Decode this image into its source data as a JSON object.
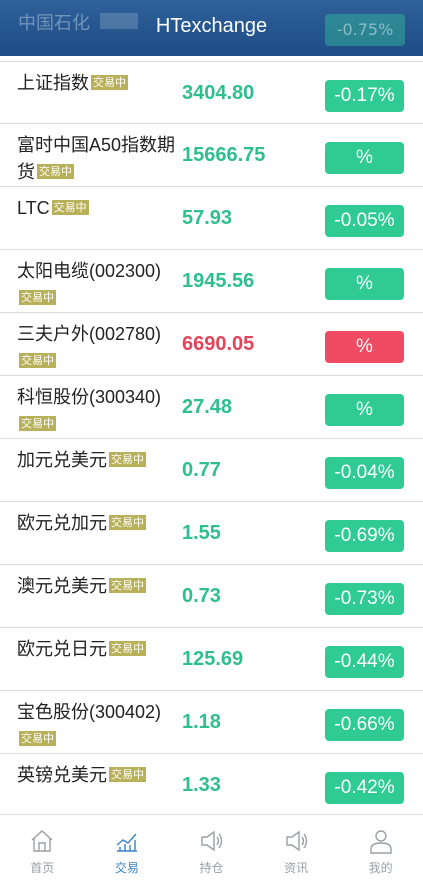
{
  "header": {
    "title": "HTexchange",
    "ghost_name": "中国石化",
    "ghost_change": "-0.75%"
  },
  "badge_text": "交易中",
  "rows": [
    {
      "name": "上证指数",
      "price": "3404.80",
      "change": "-0.17%",
      "direction": "up"
    },
    {
      "name": "富时中国A50指数期货",
      "price": "15666.75",
      "change": "%",
      "direction": "up"
    },
    {
      "name": "LTC",
      "price": "57.93",
      "change": "-0.05%",
      "direction": "up"
    },
    {
      "name": "太阳电缆(002300)",
      "price": "1945.56",
      "change": "%",
      "direction": "up"
    },
    {
      "name": "三夫户外(002780)",
      "price": "6690.05",
      "change": "%",
      "direction": "down"
    },
    {
      "name": "科恒股份(300340)",
      "price": "27.48",
      "change": "%",
      "direction": "up"
    },
    {
      "name": "加元兑美元",
      "price": "0.77",
      "change": "-0.04%",
      "direction": "up"
    },
    {
      "name": "欧元兑加元",
      "price": "1.55",
      "change": "-0.69%",
      "direction": "up"
    },
    {
      "name": "澳元兑美元",
      "price": "0.73",
      "change": "-0.73%",
      "direction": "up"
    },
    {
      "name": "欧元兑日元",
      "price": "125.69",
      "change": "-0.44%",
      "direction": "up"
    },
    {
      "name": "宝色股份(300402)",
      "price": "1.18",
      "change": "-0.66%",
      "direction": "up"
    },
    {
      "name": "英镑兑美元",
      "price": "1.33",
      "change": "-0.42%",
      "direction": "up"
    }
  ],
  "tabs": [
    {
      "label": "首页",
      "icon": "home-icon",
      "active": false
    },
    {
      "label": "交易",
      "icon": "chart-icon",
      "active": true
    },
    {
      "label": "持仓",
      "icon": "speaker-icon",
      "active": false
    },
    {
      "label": "资讯",
      "icon": "speaker-icon",
      "active": false
    },
    {
      "label": "我的",
      "icon": "user-icon",
      "active": false
    }
  ],
  "colors": {
    "header": "#1f4d85",
    "up": "#2fcb92",
    "down": "#ef4c63",
    "badge": "#b8b15a",
    "active_tab": "#3a82c4"
  }
}
